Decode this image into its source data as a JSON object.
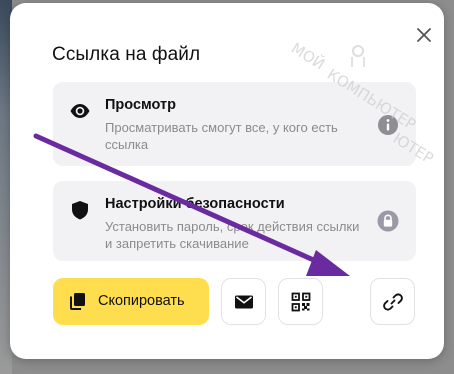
{
  "dialog": {
    "title": "Ссылка на файл",
    "close_icon": "close-icon"
  },
  "cards": [
    {
      "icon": "eye-icon",
      "title": "Просмотр",
      "description": "Просматривать смогут все, у кого есть ссылка",
      "right_icon": "info-icon"
    },
    {
      "icon": "shield-icon",
      "title": "Настройки безопасности",
      "description": "Установить пароль, срок действия ссылки и запретить скачивание",
      "right_icon": "lock-icon"
    }
  ],
  "actions": {
    "copy_label": "Скопировать",
    "copy_icon": "copy-icon",
    "mail_icon": "mail-icon",
    "qr_icon": "qr-code-icon",
    "link_icon": "link-icon"
  },
  "watermark": {
    "line1": "МОЙ",
    "line2": "КОМПЬЮТЕР",
    "line3": "ЮТЕР"
  },
  "colors": {
    "accent_yellow": "#fedd4e",
    "arrow_purple": "#6a2aa0",
    "card_bg": "#f2f2f4",
    "muted_text": "#8b8b8b"
  }
}
